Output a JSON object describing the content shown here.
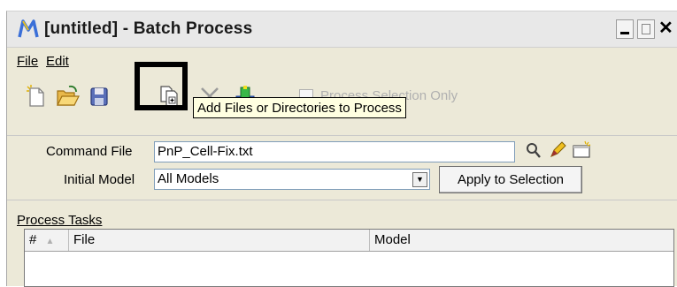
{
  "window": {
    "title": "[untitled] - Batch Process",
    "app_icon": "microstation-icon",
    "controls": {
      "minimize": "_",
      "maximize": "□",
      "close": "×"
    }
  },
  "menu": [
    {
      "label": "File",
      "mnemonic": "F"
    },
    {
      "label": "Edit",
      "mnemonic": "E"
    }
  ],
  "toolbar": {
    "tools": [
      "new-file-icon",
      "open-folder-icon",
      "save-icon",
      "add-files-icon",
      "delete-x-icon",
      "run-process-icon"
    ],
    "process_selection_only": {
      "label": "Process Selection Only",
      "checked": false,
      "enabled": false
    },
    "tooltip": "Add Files or Directories to Process"
  },
  "form": {
    "command_file": {
      "label": "Command File",
      "value": "PnP_Cell-Fix.txt"
    },
    "initial_model": {
      "label": "Initial Model",
      "value": "All Models"
    },
    "apply_button": "Apply to Selection"
  },
  "tasks": {
    "section_label": "Process Tasks",
    "columns": [
      "#",
      "File",
      "Model"
    ]
  },
  "colors": {
    "window_bg": "#ece9d8",
    "tooltip_bg": "#ffffe1",
    "field_border": "#7f9db9"
  }
}
